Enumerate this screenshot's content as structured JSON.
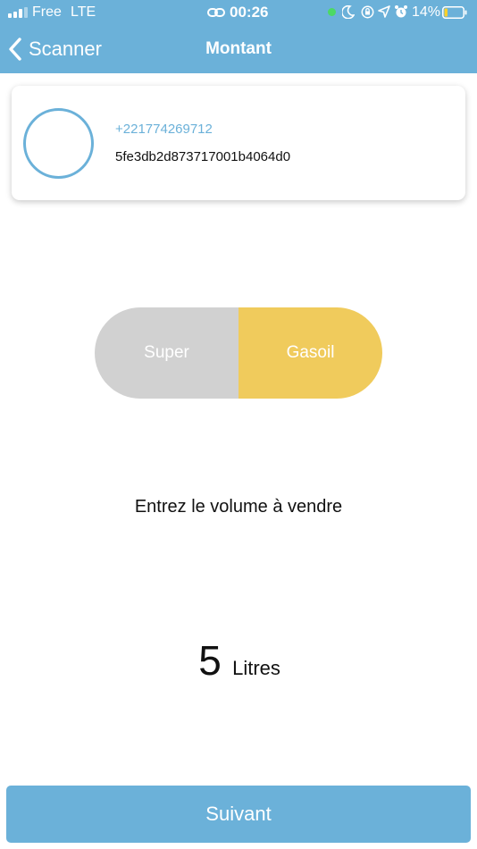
{
  "status_bar": {
    "carrier": "Free",
    "network": "LTE",
    "time": "00:26",
    "battery": "14%"
  },
  "nav": {
    "back_label": "Scanner",
    "title": "Montant"
  },
  "profile": {
    "phone": "+221774269712",
    "id": "5fe3db2d873717001b4064d0"
  },
  "fuel_toggle": {
    "options": [
      {
        "label": "Super",
        "selected": false
      },
      {
        "label": "Gasoil",
        "selected": true
      }
    ]
  },
  "prompt": "Entrez le volume à vendre",
  "volume": {
    "value": "5",
    "unit": "Litres"
  },
  "next_button": "Suivant",
  "colors": {
    "accent": "#6bb1d9",
    "selected_fuel": "#f0cb5c",
    "unselected_fuel": "#d1d1d1"
  }
}
